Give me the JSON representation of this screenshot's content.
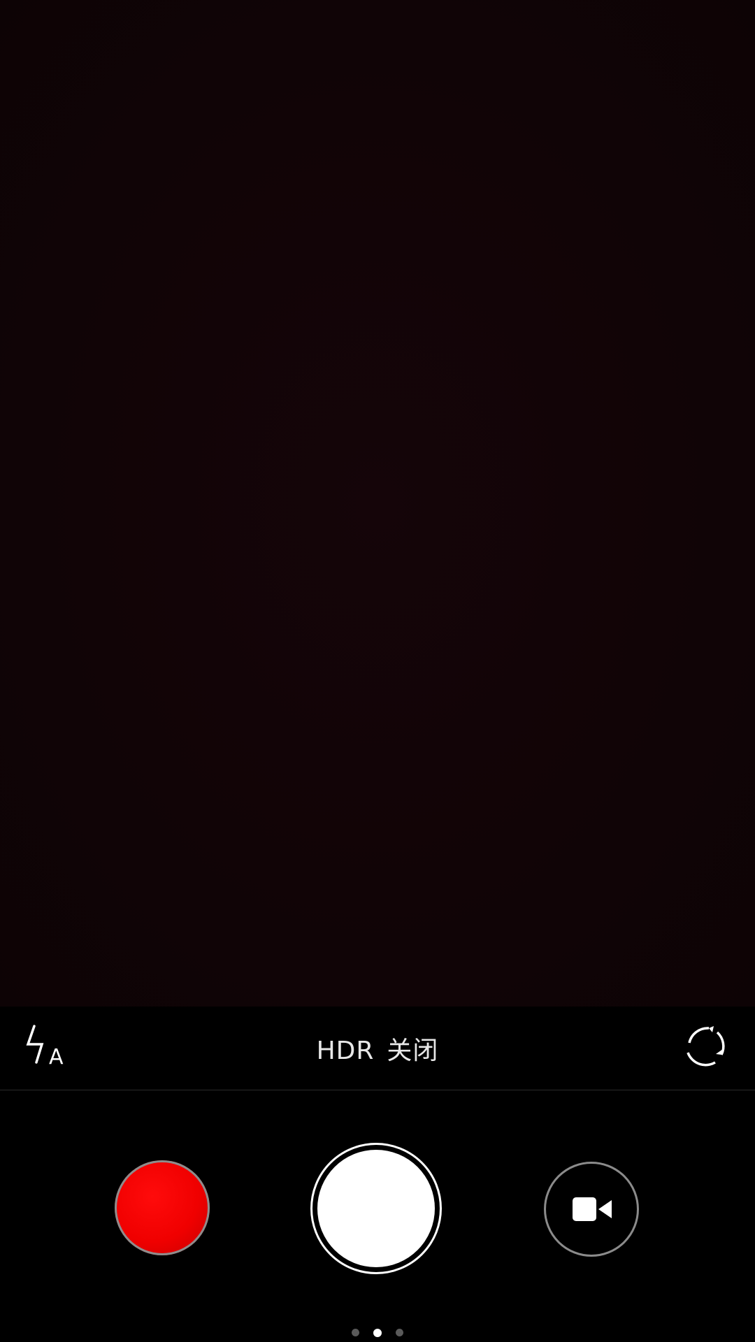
{
  "toolbar": {
    "flash_mode_letter": "A",
    "hdr_label": "HDR",
    "hdr_state": "关闭"
  },
  "icons": {
    "flash": "flash-auto-icon",
    "switch_camera": "switch-camera-icon",
    "video": "video-camera-icon"
  },
  "colors": {
    "filter_button": "#ff0000",
    "shutter": "#ffffff",
    "viewfinder": "#110406"
  },
  "page_indicator": {
    "count": 3,
    "active_index": 1
  }
}
